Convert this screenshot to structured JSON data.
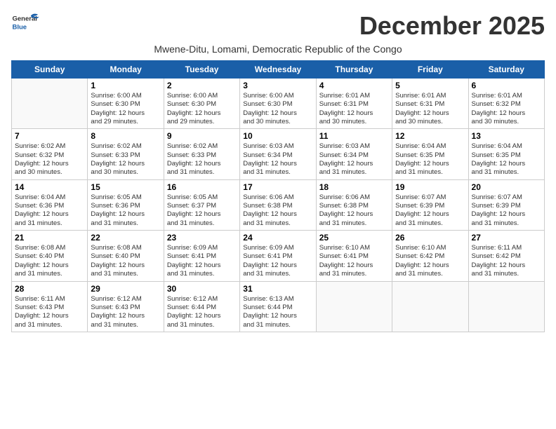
{
  "header": {
    "logo_general": "General",
    "logo_blue": "Blue",
    "month_title": "December 2025",
    "subtitle": "Mwene-Ditu, Lomami, Democratic Republic of the Congo"
  },
  "days_of_week": [
    "Sunday",
    "Monday",
    "Tuesday",
    "Wednesday",
    "Thursday",
    "Friday",
    "Saturday"
  ],
  "weeks": [
    [
      {
        "day": "",
        "info": ""
      },
      {
        "day": "1",
        "info": "Sunrise: 6:00 AM\nSunset: 6:30 PM\nDaylight: 12 hours\nand 29 minutes."
      },
      {
        "day": "2",
        "info": "Sunrise: 6:00 AM\nSunset: 6:30 PM\nDaylight: 12 hours\nand 29 minutes."
      },
      {
        "day": "3",
        "info": "Sunrise: 6:00 AM\nSunset: 6:30 PM\nDaylight: 12 hours\nand 30 minutes."
      },
      {
        "day": "4",
        "info": "Sunrise: 6:01 AM\nSunset: 6:31 PM\nDaylight: 12 hours\nand 30 minutes."
      },
      {
        "day": "5",
        "info": "Sunrise: 6:01 AM\nSunset: 6:31 PM\nDaylight: 12 hours\nand 30 minutes."
      },
      {
        "day": "6",
        "info": "Sunrise: 6:01 AM\nSunset: 6:32 PM\nDaylight: 12 hours\nand 30 minutes."
      }
    ],
    [
      {
        "day": "7",
        "info": "Sunrise: 6:02 AM\nSunset: 6:32 PM\nDaylight: 12 hours\nand 30 minutes."
      },
      {
        "day": "8",
        "info": "Sunrise: 6:02 AM\nSunset: 6:33 PM\nDaylight: 12 hours\nand 30 minutes."
      },
      {
        "day": "9",
        "info": "Sunrise: 6:02 AM\nSunset: 6:33 PM\nDaylight: 12 hours\nand 31 minutes."
      },
      {
        "day": "10",
        "info": "Sunrise: 6:03 AM\nSunset: 6:34 PM\nDaylight: 12 hours\nand 31 minutes."
      },
      {
        "day": "11",
        "info": "Sunrise: 6:03 AM\nSunset: 6:34 PM\nDaylight: 12 hours\nand 31 minutes."
      },
      {
        "day": "12",
        "info": "Sunrise: 6:04 AM\nSunset: 6:35 PM\nDaylight: 12 hours\nand 31 minutes."
      },
      {
        "day": "13",
        "info": "Sunrise: 6:04 AM\nSunset: 6:35 PM\nDaylight: 12 hours\nand 31 minutes."
      }
    ],
    [
      {
        "day": "14",
        "info": "Sunrise: 6:04 AM\nSunset: 6:36 PM\nDaylight: 12 hours\nand 31 minutes."
      },
      {
        "day": "15",
        "info": "Sunrise: 6:05 AM\nSunset: 6:36 PM\nDaylight: 12 hours\nand 31 minutes."
      },
      {
        "day": "16",
        "info": "Sunrise: 6:05 AM\nSunset: 6:37 PM\nDaylight: 12 hours\nand 31 minutes."
      },
      {
        "day": "17",
        "info": "Sunrise: 6:06 AM\nSunset: 6:38 PM\nDaylight: 12 hours\nand 31 minutes."
      },
      {
        "day": "18",
        "info": "Sunrise: 6:06 AM\nSunset: 6:38 PM\nDaylight: 12 hours\nand 31 minutes."
      },
      {
        "day": "19",
        "info": "Sunrise: 6:07 AM\nSunset: 6:39 PM\nDaylight: 12 hours\nand 31 minutes."
      },
      {
        "day": "20",
        "info": "Sunrise: 6:07 AM\nSunset: 6:39 PM\nDaylight: 12 hours\nand 31 minutes."
      }
    ],
    [
      {
        "day": "21",
        "info": "Sunrise: 6:08 AM\nSunset: 6:40 PM\nDaylight: 12 hours\nand 31 minutes."
      },
      {
        "day": "22",
        "info": "Sunrise: 6:08 AM\nSunset: 6:40 PM\nDaylight: 12 hours\nand 31 minutes."
      },
      {
        "day": "23",
        "info": "Sunrise: 6:09 AM\nSunset: 6:41 PM\nDaylight: 12 hours\nand 31 minutes."
      },
      {
        "day": "24",
        "info": "Sunrise: 6:09 AM\nSunset: 6:41 PM\nDaylight: 12 hours\nand 31 minutes."
      },
      {
        "day": "25",
        "info": "Sunrise: 6:10 AM\nSunset: 6:41 PM\nDaylight: 12 hours\nand 31 minutes."
      },
      {
        "day": "26",
        "info": "Sunrise: 6:10 AM\nSunset: 6:42 PM\nDaylight: 12 hours\nand 31 minutes."
      },
      {
        "day": "27",
        "info": "Sunrise: 6:11 AM\nSunset: 6:42 PM\nDaylight: 12 hours\nand 31 minutes."
      }
    ],
    [
      {
        "day": "28",
        "info": "Sunrise: 6:11 AM\nSunset: 6:43 PM\nDaylight: 12 hours\nand 31 minutes."
      },
      {
        "day": "29",
        "info": "Sunrise: 6:12 AM\nSunset: 6:43 PM\nDaylight: 12 hours\nand 31 minutes."
      },
      {
        "day": "30",
        "info": "Sunrise: 6:12 AM\nSunset: 6:44 PM\nDaylight: 12 hours\nand 31 minutes."
      },
      {
        "day": "31",
        "info": "Sunrise: 6:13 AM\nSunset: 6:44 PM\nDaylight: 12 hours\nand 31 minutes."
      },
      {
        "day": "",
        "info": ""
      },
      {
        "day": "",
        "info": ""
      },
      {
        "day": "",
        "info": ""
      }
    ]
  ]
}
